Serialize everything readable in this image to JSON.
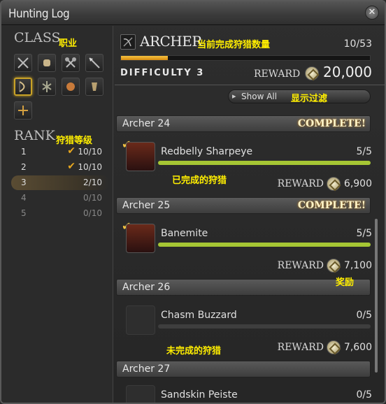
{
  "window": {
    "title": "Hunting Log",
    "close_icon": "close-icon"
  },
  "left": {
    "class_heading": "CLASS",
    "class_note": "职业",
    "classes": [
      "gladiator",
      "pugilist",
      "marauder",
      "lancer",
      "archer",
      "conjurer",
      "thaumaturge",
      "arcanist",
      "rogue"
    ],
    "selected_class": "archer",
    "rank_heading": "RANK",
    "rank_note": "狩猎等级",
    "ranks": [
      {
        "n": "1",
        "v": "10/10",
        "done": true
      },
      {
        "n": "2",
        "v": "10/10",
        "done": true
      },
      {
        "n": "3",
        "v": "2/10",
        "done": false
      },
      {
        "n": "4",
        "v": "0/10",
        "done": false
      },
      {
        "n": "5",
        "v": "0/10",
        "done": false
      }
    ]
  },
  "right": {
    "job": "ARCHER",
    "job_note": "当前完成狩猎数量",
    "progress_text": "10/53",
    "progress_fraction": 0.189,
    "difficulty": "DIFFICULTY 3",
    "reward_label": "REWARD",
    "reward_total": "20,000",
    "show_all": "Show All",
    "filter_note": "显示过滤",
    "completed_note": "已完成的狩猎",
    "reward_note": "奖励",
    "incomplete_note": "未完成的狩猎",
    "sections": [
      {
        "label": "Archer 24",
        "status": "COMPLETE!"
      },
      {
        "label": "Archer 25",
        "status": "COMPLETE!"
      },
      {
        "label": "Archer 26",
        "status": ""
      },
      {
        "label": "Archer 27",
        "status": ""
      }
    ],
    "monsters": [
      {
        "name": "Redbelly Sharpeye",
        "count": "5/5",
        "fill": 1.0,
        "reward": "6,900"
      },
      {
        "name": "Banemite",
        "count": "5/5",
        "fill": 1.0,
        "reward": "7,100"
      },
      {
        "name": "Chasm Buzzard",
        "count": "0/5",
        "fill": 0.0,
        "reward": "7,600"
      },
      {
        "name": "Sandskin Peiste",
        "count": "0/5",
        "fill": 0.0,
        "reward": ""
      }
    ]
  },
  "colors": {
    "accent": "#c9a227",
    "note": "#ffee00",
    "bar": "#a6c634"
  }
}
